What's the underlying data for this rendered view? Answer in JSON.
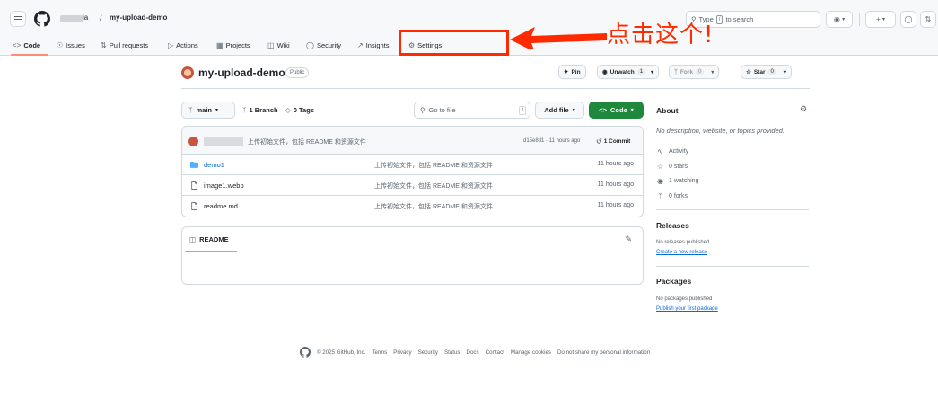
{
  "header": {
    "owner_suffix": "ia",
    "separator": "/",
    "repo": "my-upload-demo",
    "search_label": "Type",
    "search_key": "/",
    "search_suffix": "to search",
    "icons": [
      "hamburger-icon",
      "github-logo",
      "search-icon",
      "copilot-icon",
      "plus-icon",
      "issues-icon",
      "pull-requests-icon"
    ]
  },
  "nav": {
    "tabs": [
      {
        "label": "Code",
        "icon": "code-icon"
      },
      {
        "label": "Issues",
        "icon": "issue-icon"
      },
      {
        "label": "Pull requests",
        "icon": "git-pull-request-icon"
      },
      {
        "label": "Actions",
        "icon": "play-icon"
      },
      {
        "label": "Projects",
        "icon": "table-icon"
      },
      {
        "label": "Wiki",
        "icon": "book-icon"
      },
      {
        "label": "Security",
        "icon": "shield-icon"
      },
      {
        "label": "Insights",
        "icon": "graph-icon"
      },
      {
        "label": "Settings",
        "icon": "gear-icon"
      }
    ],
    "active_color": "#fd8c73"
  },
  "annotation": {
    "text": "点击这个!",
    "color": "#ff2a00"
  },
  "repo": {
    "name": "my-upload-demo",
    "visibility": "Public",
    "pin_label": "Pin",
    "watch_label": "Unwatch",
    "watch_count": "1",
    "fork_label": "Fork",
    "fork_count": "0",
    "star_label": "Star",
    "star_count": "0"
  },
  "branchbar": {
    "branch": "main",
    "branches": "1 Branch",
    "tags": "0 Tags",
    "goto_placeholder": "Go to file",
    "goto_key": "t",
    "add_file": "Add file",
    "code": "Code",
    "code_color": "#1f883d"
  },
  "latest_commit": {
    "message": "上传初始文件，包括 README 和资源文件",
    "hash_time": "d15e8d1 · 11 hours ago",
    "commit_count": "1 Commit"
  },
  "files": [
    {
      "name": "demo1",
      "type": "dir",
      "message": "上传初始文件，包括 README 和资源文件",
      "time": "11 hours ago"
    },
    {
      "name": "image1.webp",
      "type": "file",
      "message": "上传初始文件，包括 README 和资源文件",
      "time": "11 hours ago"
    },
    {
      "name": "readme.md",
      "type": "file",
      "message": "上传初始文件，包括 README 和资源文件",
      "time": "11 hours ago"
    }
  ],
  "readme": {
    "title": "README"
  },
  "sidebar": {
    "about_title": "About",
    "description": "No description, website, or topics provided.",
    "activity": "Activity",
    "stars": "0 stars",
    "watching": "1 watching",
    "forks": "0 forks",
    "releases_title": "Releases",
    "releases_note": "No releases published",
    "releases_link": "Create a new release",
    "packages_title": "Packages",
    "packages_note": "No packages published",
    "packages_link": "Publish your first package"
  },
  "footer": {
    "copyright": "© 2025 GitHub, Inc.",
    "links": [
      "Terms",
      "Privacy",
      "Security",
      "Status",
      "Docs",
      "Contact",
      "Manage cookies",
      "Do not share my personal information"
    ]
  }
}
